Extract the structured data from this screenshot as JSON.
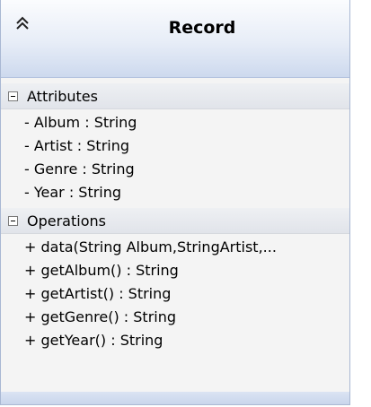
{
  "class": {
    "name": "Record",
    "collapse_icon": "double-chevron-up-icon"
  },
  "attributes": {
    "label": "Attributes",
    "items": [
      "- Album : String",
      "- Artist : String",
      "- Genre : String",
      "- Year : String"
    ]
  },
  "operations": {
    "label": "Operations",
    "items": [
      "+ data(String Album,StringArtist,...",
      "+ getAlbum() : String",
      "+ getArtist() : String",
      "+ getGenre() : String",
      "+ getYear() : String"
    ]
  },
  "colors": {
    "header_gradient_top": "#fbfcfe",
    "header_gradient_bottom": "#cdd9ee",
    "border": "#a9b8d3",
    "body_background": "#f4f4f4"
  }
}
